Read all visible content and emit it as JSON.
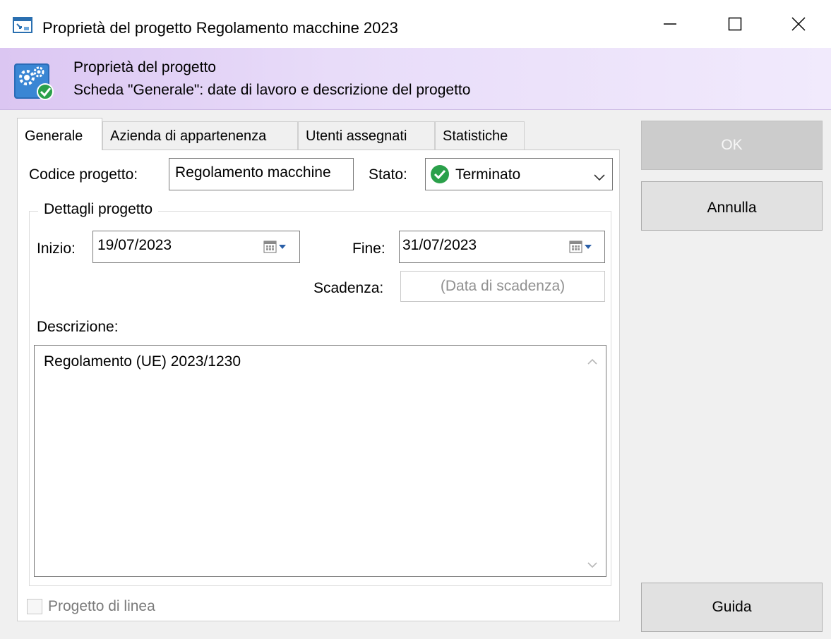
{
  "window": {
    "title": "Proprietà del progetto Regolamento macchine 2023",
    "icons": [
      "window-app-icon",
      "minimize-icon",
      "maximize-icon",
      "close-icon"
    ]
  },
  "header": {
    "title": "Proprietà del progetto",
    "subtitle": "Scheda \"Generale\": date di lavoro e descrizione del progetto",
    "icon": "gears-check-icon",
    "gradient_start": "#dbc6f2",
    "gradient_end": "#f1eafc"
  },
  "tabs": [
    {
      "label": "Generale",
      "active": true
    },
    {
      "label": "Azienda di appartenenza",
      "active": false
    },
    {
      "label": "Utenti assegnati",
      "active": false
    },
    {
      "label": "Statistiche",
      "active": false
    }
  ],
  "form": {
    "codice_label": "Codice progetto:",
    "codice_value": "Regolamento macchine",
    "stato_label": "Stato:",
    "stato_value": "Terminato",
    "stato_icon": "check-circle-icon",
    "stato_color": "#2aa04a",
    "group_title": "Dettagli progetto",
    "inizio_label": "Inizio:",
    "inizio_value": "19/07/2023",
    "fine_label": "Fine:",
    "fine_value": "31/07/2023",
    "scadenza_label": "Scadenza:",
    "scadenza_placeholder": "(Data di scadenza)",
    "descrizione_label": "Descrizione:",
    "descrizione_value": "Regolamento (UE) 2023/1230",
    "linea_label": "Progetto di linea",
    "linea_checked": false
  },
  "buttons": {
    "ok": "OK",
    "annulla": "Annulla",
    "guida": "Guida"
  }
}
